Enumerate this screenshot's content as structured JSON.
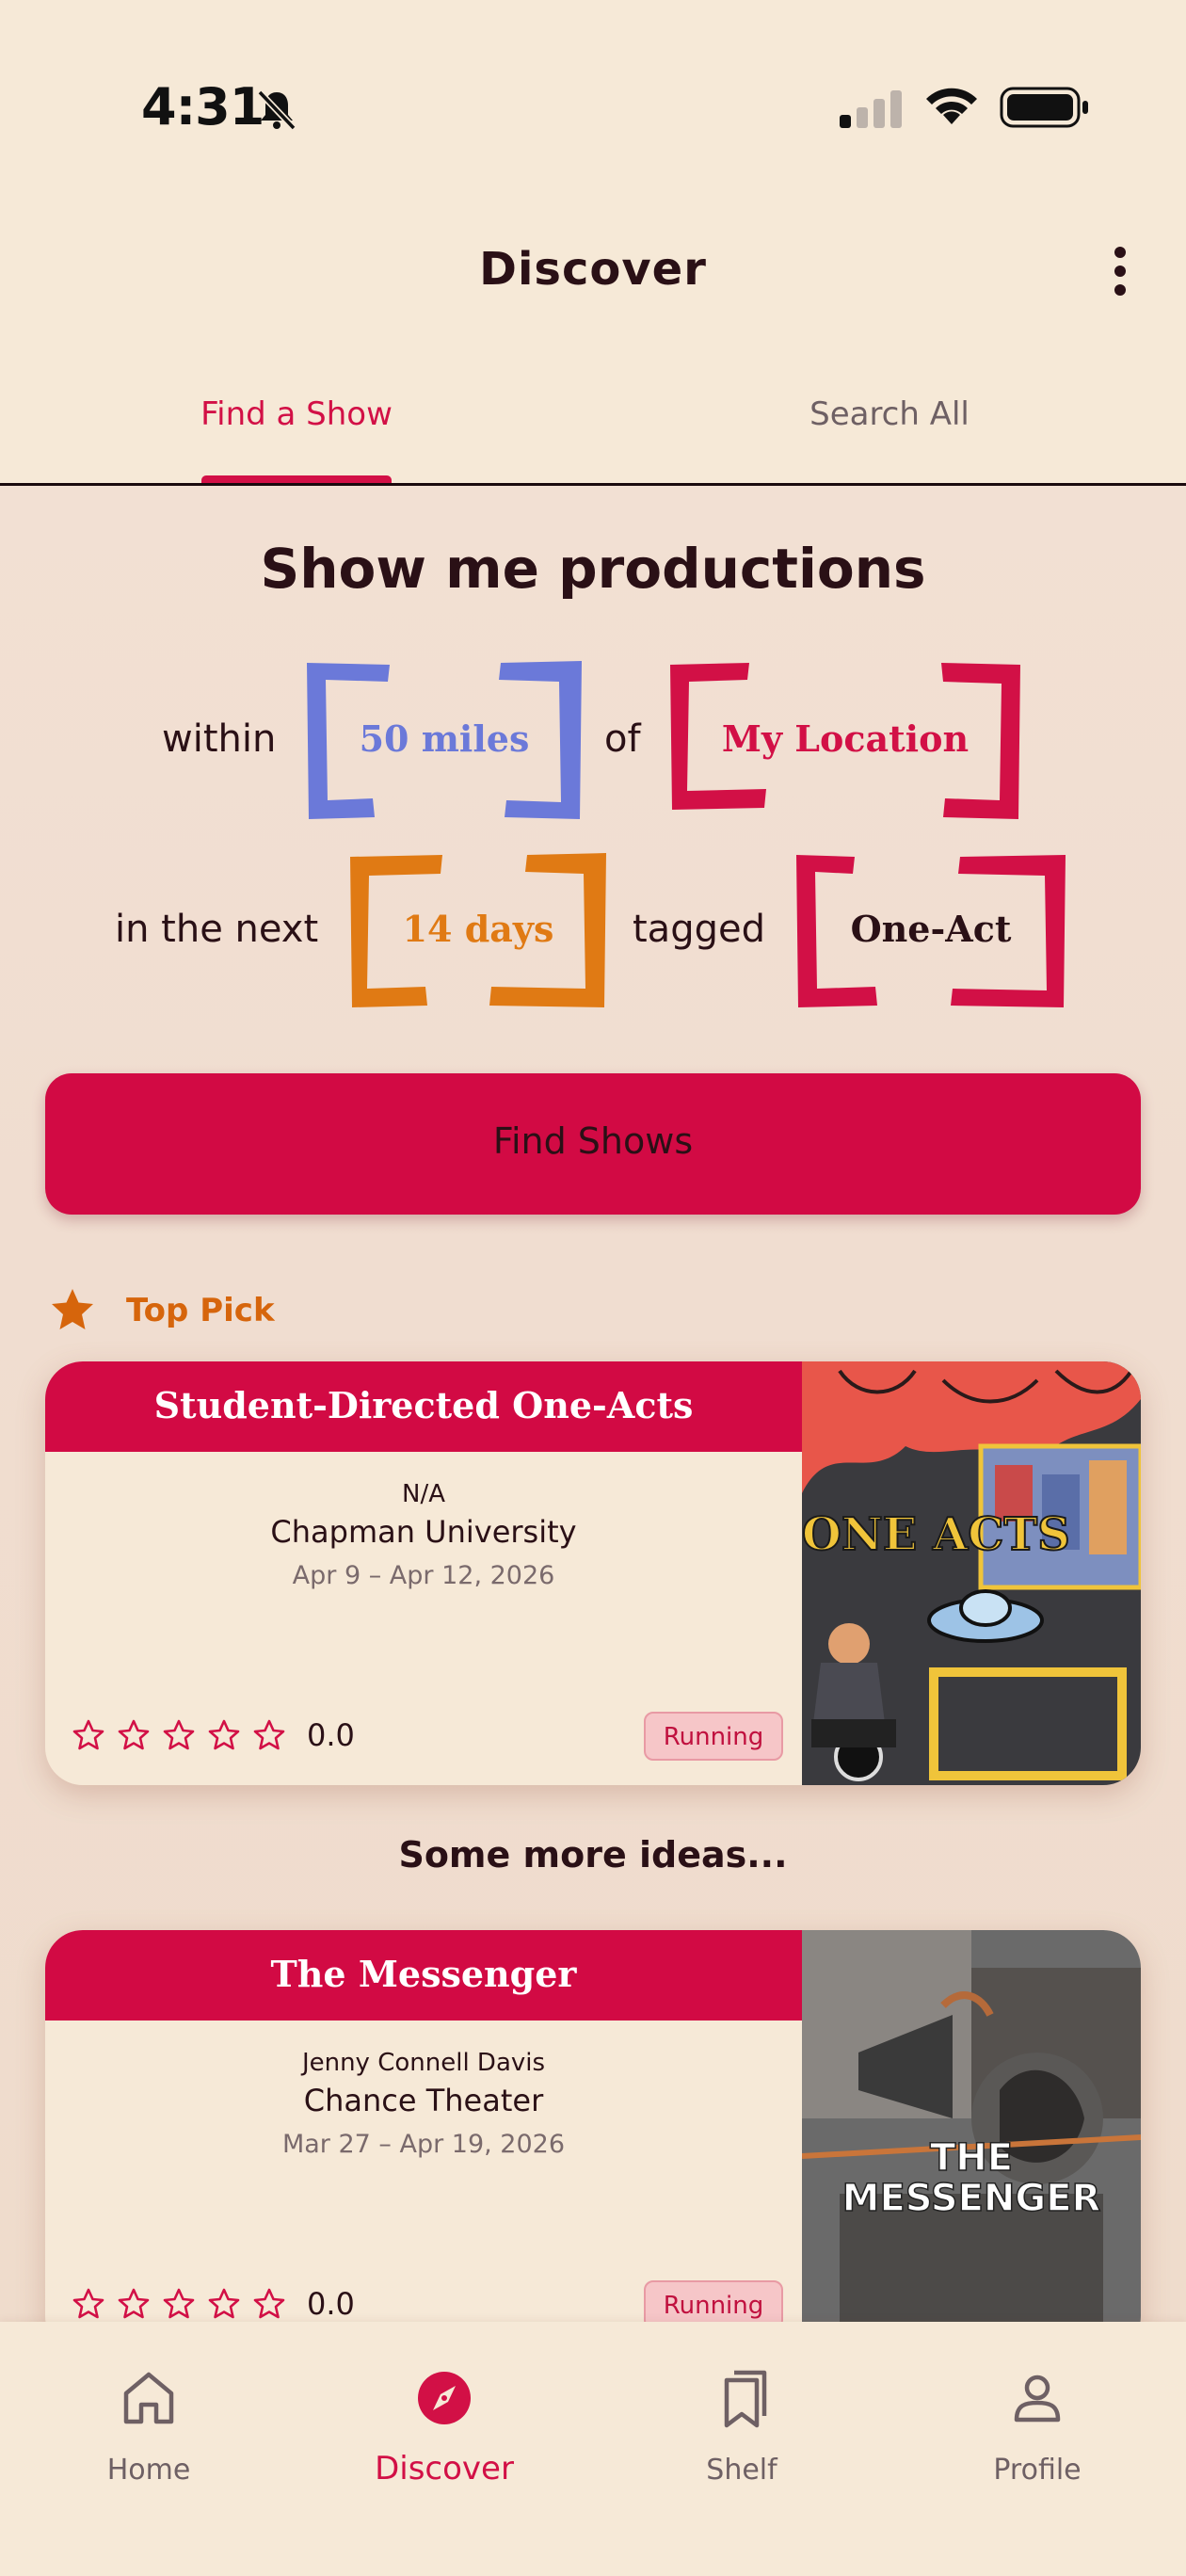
{
  "status_bar": {
    "time": "4:31"
  },
  "header": {
    "title": "Discover"
  },
  "tabs": [
    {
      "label": "Find a Show",
      "active": true
    },
    {
      "label": "Search All",
      "active": false
    }
  ],
  "finder": {
    "title": "Show me productions",
    "within_word": "within",
    "distance": "50 miles",
    "of_word": "of",
    "location": "My Location",
    "next_word": "in the next",
    "days": "14 days",
    "tagged_word": "tagged",
    "tag": "One-Act",
    "button_label": "Find Shows"
  },
  "top_pick": {
    "label": "Top Pick"
  },
  "cards": [
    {
      "title": "Student-Directed One-Acts",
      "author": "N/A",
      "venue": "Chapman University",
      "dates": "Apr 9 – Apr 12, 2026",
      "rating": "0.0",
      "status": "Running",
      "poster_text": "ONE ACTS"
    },
    {
      "title": "The Messenger",
      "author": "Jenny Connell Davis",
      "venue": "Chance Theater",
      "dates": "Mar 27 – Apr 19, 2026",
      "rating": "0.0",
      "status": "Running",
      "poster_text_1": "THE",
      "poster_text_2": "MESSENGER"
    }
  ],
  "more_ideas": "Some more ideas...",
  "bottom_nav": [
    {
      "label": "Home",
      "icon": "home-icon",
      "active": false
    },
    {
      "label": "Discover",
      "icon": "compass-icon",
      "active": true
    },
    {
      "label": "Shelf",
      "icon": "bookmarks-icon",
      "active": false
    },
    {
      "label": "Profile",
      "icon": "person-icon",
      "active": false
    }
  ],
  "colors": {
    "accent": "#d20a44",
    "distance": "#6b79d9",
    "days": "#e07a14",
    "background": "#f6e9d7"
  }
}
